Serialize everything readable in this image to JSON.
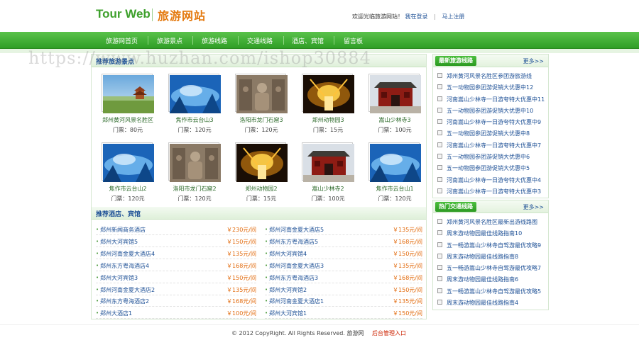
{
  "header": {
    "logo_en": "Tour Web",
    "logo_cn": "旅游网站",
    "welcome": "欢迎光临旅游网站！",
    "login": "我在登录",
    "separator": "|",
    "register": "马上注册"
  },
  "nav": [
    "旅游网首页",
    "旅游景点",
    "旅游线路",
    "交通线路",
    "酒店、宾馆",
    "留言板"
  ],
  "watermark": "https://www.huzhan.com/ishop30884",
  "scenic": {
    "title": "推荐旅游景点",
    "items": [
      {
        "name": "郑州黄河风景名胜区",
        "price": "门票：80元",
        "scene": "pavilion"
      },
      {
        "name": "焦作市云台山3",
        "price": "门票：120元",
        "scene": "mist"
      },
      {
        "name": "洛阳市龙门石窟3",
        "price": "门票：120元",
        "scene": "buddha"
      },
      {
        "name": "郑州动物园3",
        "price": "门票：15元",
        "scene": "lights"
      },
      {
        "name": "嵩山少林寺3",
        "price": "门票：100元",
        "scene": "temple"
      },
      {
        "name": "焦作市云台山2",
        "price": "门票：120元",
        "scene": "mist"
      },
      {
        "name": "洛阳市龙门石窟2",
        "price": "门票：120元",
        "scene": "buddha"
      },
      {
        "name": "郑州动物园2",
        "price": "门票：15元",
        "scene": "lights"
      },
      {
        "name": "嵩山少林寺2",
        "price": "门票：100元",
        "scene": "temple"
      },
      {
        "name": "焦作市云台山1",
        "price": "门票：120元",
        "scene": "mist"
      }
    ]
  },
  "hotels": {
    "title": "推荐酒店、宾馆",
    "left": [
      {
        "name": "郑州新闻商务酒店",
        "price": "￥230元/间"
      },
      {
        "name": "郑州大河宾馆5",
        "price": "￥150元/间"
      },
      {
        "name": "郑州河南金夏大酒店4",
        "price": "￥135元/间"
      },
      {
        "name": "郑州东方粤海酒店4",
        "price": "￥168元/间"
      },
      {
        "name": "郑州大河宾馆3",
        "price": "￥150元/间"
      },
      {
        "name": "郑州河南金夏大酒店2",
        "price": "￥135元/间"
      },
      {
        "name": "郑州东方粤海酒店2",
        "price": "￥168元/间"
      },
      {
        "name": "郑州大酒店1",
        "price": "￥100元/间"
      }
    ],
    "right": [
      {
        "name": "郑州河南金夏大酒店5",
        "price": "￥135元/间"
      },
      {
        "name": "郑州东方粤海酒店5",
        "price": "￥168元/间"
      },
      {
        "name": "郑州大河宾馆4",
        "price": "￥150元/间"
      },
      {
        "name": "郑州河南金夏大酒店3",
        "price": "￥135元/间"
      },
      {
        "name": "郑州东方粤海酒店3",
        "price": "￥168元/间"
      },
      {
        "name": "郑州大河宾馆2",
        "price": "￥150元/间"
      },
      {
        "name": "郑州河南金夏大酒店1",
        "price": "￥135元/间"
      },
      {
        "name": "郑州大河宾馆1",
        "price": "￥150元/间"
      }
    ]
  },
  "latest_routes": {
    "title": "最新旅游线路",
    "more": "更多>>",
    "items": [
      "郑州黄河风景名胜区参团游旅游线",
      "五一动物园参团游促销大优惠中12",
      "河南嵩山少林寺一日游夸特大优惠中11",
      "五一动物园参团游促销大优惠中10",
      "河南嵩山少林寺一日游夸特大优惠中9",
      "五一动物园参团游促销大优惠中8",
      "河南嵩山少林寺一日游夸特大优惠中7",
      "五一动物园参团游促销大优惠中6",
      "五一动物园参团游促销大优惠中5",
      "河南嵩山少林寺一日游夸特大优惠中4",
      "河南嵩山少林寺一日游夸特大优惠中3"
    ]
  },
  "hot_traffic": {
    "title": "热门交通线路",
    "more": "更多>>",
    "items": [
      "郑州黄河风景名胜区最新出游线路图",
      "周末游动物园最佳线路指南10",
      "五一畅游嵩山少林寺自驾游最优攻略9",
      "周末游动物园最佳线路指南8",
      "五一畅游嵩山少林寺自驾游最优攻略7",
      "周末游动物园最佳线路指南6",
      "五一畅游嵩山少林寺自驾游最优攻略5",
      "周末游动物园最佳线路指南4"
    ]
  },
  "footer": {
    "copyright": "© 2012 CopyRight. All Rights Reserved. 旅游网",
    "admin": "后台管理入口"
  },
  "colors": {
    "brand_green": "#3ea02c",
    "nav_green": "#2f9e26",
    "link_blue": "#1c4f95",
    "price_orange": "#e26a0c"
  }
}
